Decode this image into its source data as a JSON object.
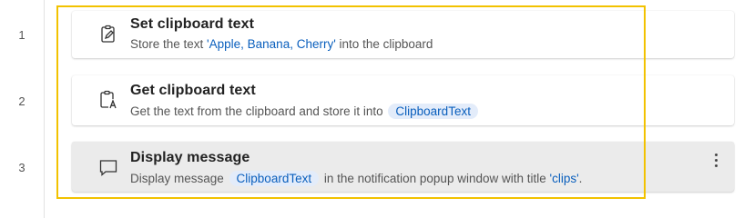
{
  "line_numbers": [
    "1",
    "2",
    "3"
  ],
  "actions": [
    {
      "title": "Set clipboard text",
      "icon": "clipboard-edit-icon",
      "desc_prefix": "Store the text ",
      "string_value": "'Apple, Banana, Cherry'",
      "desc_suffix": " into the clipboard"
    },
    {
      "title": "Get clipboard text",
      "icon": "clipboard-text-icon",
      "desc_prefix": "Get the text from the clipboard and store it into ",
      "variable": "ClipboardText"
    },
    {
      "title": "Display message",
      "icon": "message-icon",
      "desc_prefix": "Display message ",
      "variable": "ClipboardText",
      "desc_middle": " in the notification popup window with title ",
      "string_value": "'clips'",
      "desc_suffix": "."
    }
  ],
  "colors": {
    "selection_outline": "#f2c200",
    "string_value": "#0a5fbd",
    "variable_pill_bg": "#e3ecfa",
    "active_card_bg": "#ebebeb"
  }
}
